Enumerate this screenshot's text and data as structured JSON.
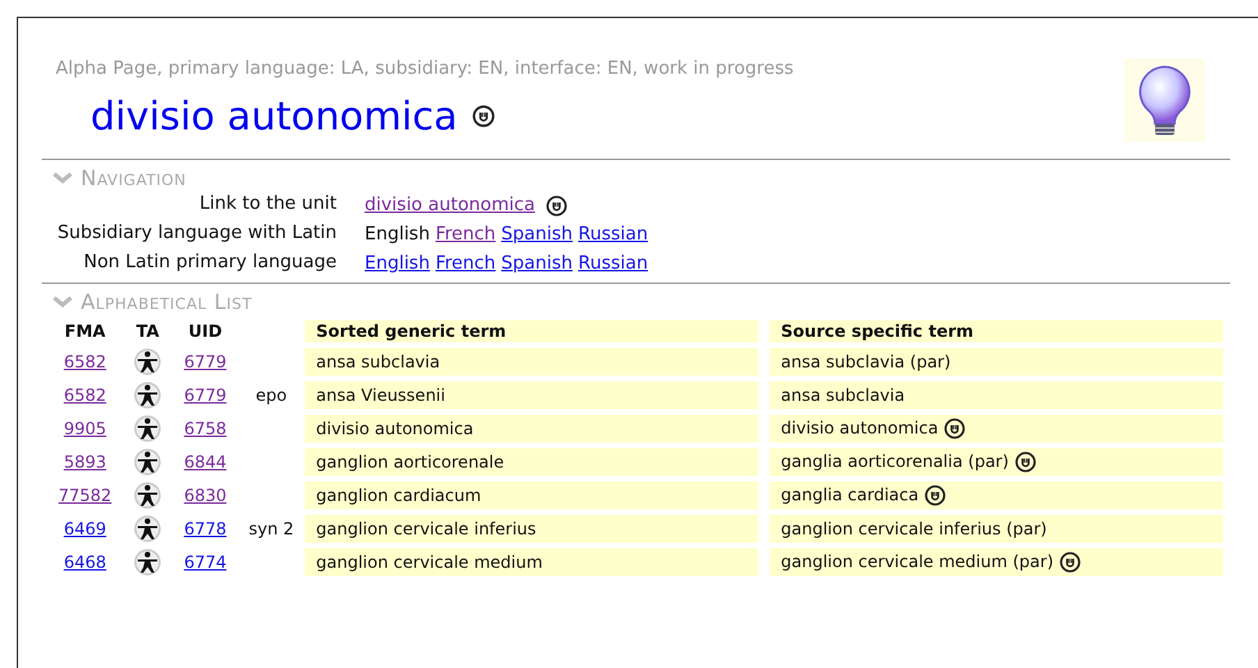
{
  "header": {
    "subtitle": "Alpha Page, primary language: LA, subsidiary: EN, interface: EN, work in progress",
    "title": "divisio autonomica"
  },
  "navigation": {
    "heading": "Navigation",
    "rows": [
      {
        "label": "Link to the unit",
        "items": [
          {
            "kind": "link",
            "text": "divisio autonomica",
            "visited": true,
            "icon": true
          }
        ]
      },
      {
        "label": "Subsidiary language with Latin",
        "items": [
          {
            "kind": "text",
            "text": "English"
          },
          {
            "kind": "link",
            "text": "French",
            "visited": true
          },
          {
            "kind": "link",
            "text": "Spanish",
            "visited": false
          },
          {
            "kind": "link",
            "text": "Russian",
            "visited": false
          }
        ]
      },
      {
        "label": "Non Latin primary language",
        "items": [
          {
            "kind": "link",
            "text": "English",
            "visited": false
          },
          {
            "kind": "link",
            "text": "French",
            "visited": false
          },
          {
            "kind": "link",
            "text": "Spanish",
            "visited": false
          },
          {
            "kind": "link",
            "text": "Russian",
            "visited": false
          }
        ]
      }
    ]
  },
  "alphabetical_list": {
    "heading": "Alphabetical List",
    "columns": [
      "FMA",
      "TA",
      "UID",
      "Sorted generic term",
      "Source specific term"
    ],
    "rows": [
      {
        "fma": "6582",
        "fma_visited": true,
        "uid": "6779",
        "uid_visited": true,
        "note": "",
        "generic": "ansa subclavia",
        "specific": "ansa subclavia (par)",
        "icon": false
      },
      {
        "fma": "6582",
        "fma_visited": true,
        "uid": "6779",
        "uid_visited": true,
        "note": "epo",
        "generic": "ansa Vieussenii",
        "specific": "ansa subclavia",
        "icon": false
      },
      {
        "fma": "9905",
        "fma_visited": true,
        "uid": "6758",
        "uid_visited": true,
        "note": "",
        "generic": "divisio autonomica",
        "specific": "divisio autonomica",
        "icon": true
      },
      {
        "fma": "5893",
        "fma_visited": true,
        "uid": "6844",
        "uid_visited": true,
        "note": "",
        "generic": "ganglion aorticorenale",
        "specific": "ganglia aorticorenalia (par)",
        "icon": true
      },
      {
        "fma": "77582",
        "fma_visited": true,
        "uid": "6830",
        "uid_visited": true,
        "note": "",
        "generic": "ganglion cardiacum",
        "specific": "ganglia cardiaca",
        "icon": true
      },
      {
        "fma": "6469",
        "fma_visited": false,
        "uid": "6778",
        "uid_visited": false,
        "note": "syn 2",
        "generic": "ganglion cervicale inferius",
        "specific": "ganglion cervicale inferius (par)",
        "icon": false
      },
      {
        "fma": "6468",
        "fma_visited": false,
        "uid": "6774",
        "uid_visited": false,
        "note": "",
        "generic": "ganglion cervicale medium",
        "specific": "ganglion cervicale medium (par)",
        "icon": true
      }
    ]
  }
}
